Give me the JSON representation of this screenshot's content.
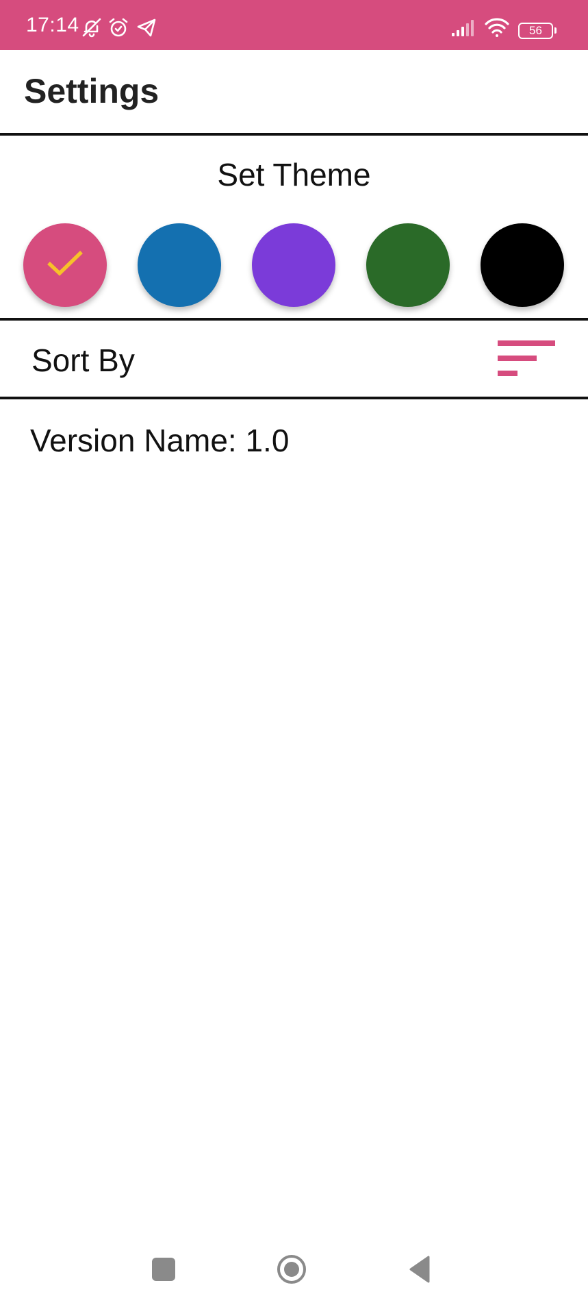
{
  "status_bar": {
    "time": "17:14",
    "battery": "56",
    "icons": [
      "bell-off-icon",
      "alarm-icon",
      "telegram-icon",
      "signal-icon",
      "wifi-icon",
      "battery-icon"
    ]
  },
  "header": {
    "title": "Settings"
  },
  "theme": {
    "title": "Set Theme",
    "options": [
      {
        "color": "#d64c7e",
        "selected": true
      },
      {
        "color": "#1470b0",
        "selected": false
      },
      {
        "color": "#7b3bd9",
        "selected": false
      },
      {
        "color": "#2a6a28",
        "selected": false
      },
      {
        "color": "#000000",
        "selected": false
      }
    ],
    "check_color": "#f7c12a"
  },
  "sort": {
    "label": "Sort By",
    "icon": "sort-icon",
    "icon_color": "#d64c7e"
  },
  "version": {
    "text": "Version Name: 1.0"
  },
  "nav_bar": {
    "icons": [
      "recent-apps-icon",
      "home-icon",
      "back-icon"
    ]
  },
  "colors": {
    "accent": "#d64c7e"
  }
}
